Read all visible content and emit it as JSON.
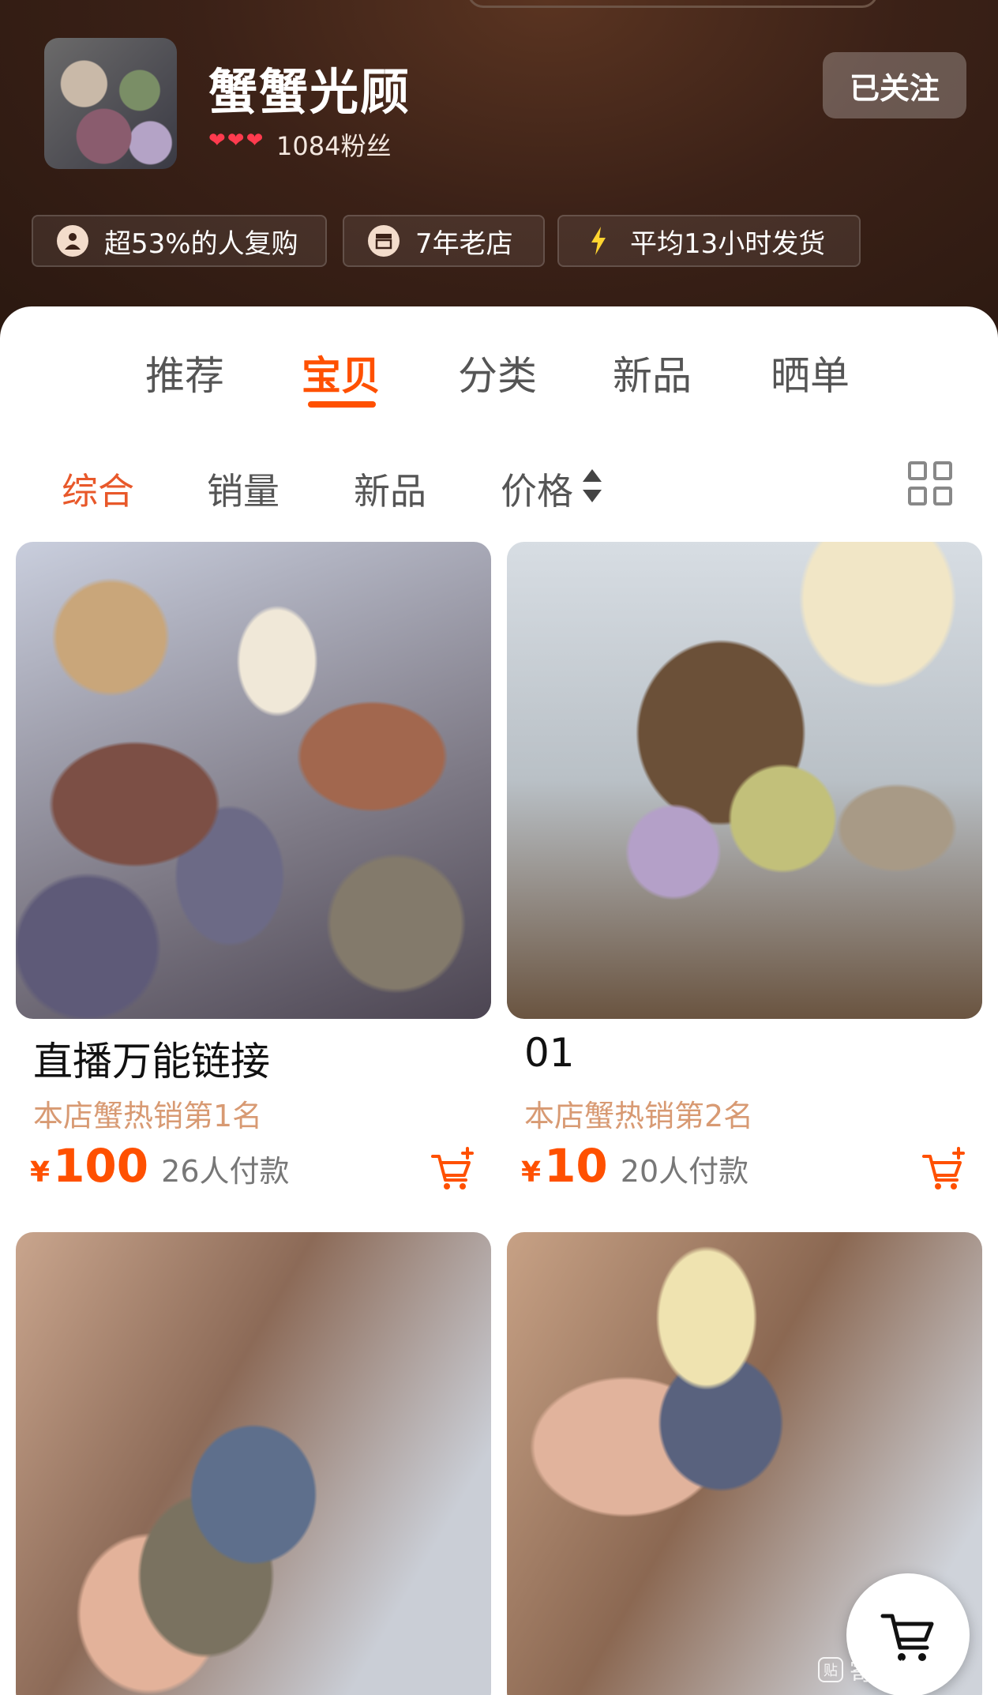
{
  "shop": {
    "name": "蟹蟹光顾",
    "fans": "1084粉丝",
    "hearts": [
      "❤",
      "❤",
      "❤"
    ],
    "follow_label": "已关注"
  },
  "chips": [
    {
      "icon": "user-icon",
      "label": "超53%的人复购"
    },
    {
      "icon": "shop-icon",
      "label": "7年老店"
    },
    {
      "icon": "lightning-icon",
      "label": "平均13小时发货"
    }
  ],
  "tabs": [
    "推荐",
    "宝贝",
    "分类",
    "新品",
    "晒单"
  ],
  "active_tab": "宝贝",
  "sort": [
    "综合",
    "销量",
    "新品",
    "价格"
  ],
  "active_sort": "综合",
  "products": [
    {
      "title": "直播万能链接",
      "rank": "本店蟹热销第1名",
      "currency": "¥",
      "price": "100",
      "sold": "26人付款"
    },
    {
      "title": "01",
      "rank": "本店蟹热销第2名",
      "currency": "¥",
      "price": "10",
      "sold": "20人付款"
    },
    {
      "title": "",
      "rank": "",
      "currency": "",
      "price": "",
      "sold": ""
    },
    {
      "title": "",
      "rank": "",
      "currency": "",
      "price": "",
      "sold": ""
    }
  ],
  "watermark": {
    "logo": "贴",
    "text": "寄居蟹吧"
  },
  "colors": {
    "accent": "#ff5000",
    "rank": "#d89a73",
    "header_bg": "#3b2117"
  }
}
